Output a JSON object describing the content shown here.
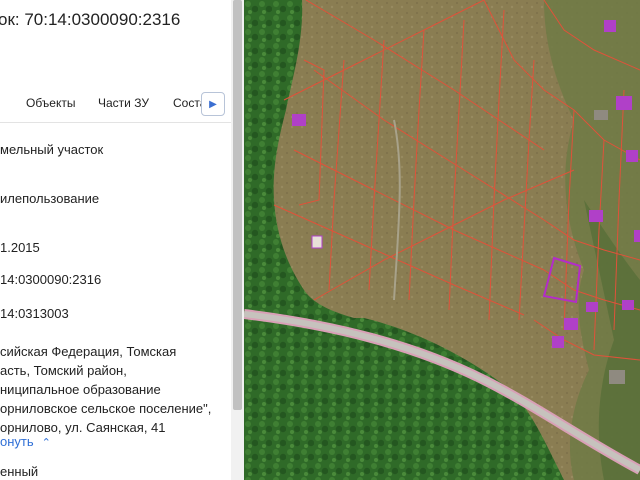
{
  "panel": {
    "title": "ок: 70:14:0300090:2316",
    "tabs": [
      {
        "label": "Объекты"
      },
      {
        "label": "Части ЗУ"
      },
      {
        "label": "Соста"
      }
    ],
    "tab_next_icon": "chevron-right-icon",
    "fields": {
      "type": "мельный участок",
      "category": "илепользование",
      "date": "1.2015",
      "cad_number": "14:0300090:2316",
      "quarter": "14:0313003",
      "address_lines": [
        "сийская Федерация, Томская",
        "асть, Томский район,",
        "ниципальное образование",
        "орниловское сельское поселение\",",
        "орнилово, ул. Саянская, 41"
      ],
      "collapse_label": "онуть",
      "status": "енный"
    }
  },
  "map": {
    "colors": {
      "forest": "#2f6a28",
      "field": "#8a7d52",
      "parcel_line": "#e0523a",
      "selected_parcel": "#b32cc9",
      "road": "#c6c2bd",
      "road_edge": "#d9a0b6",
      "building": "#b040c8"
    }
  }
}
